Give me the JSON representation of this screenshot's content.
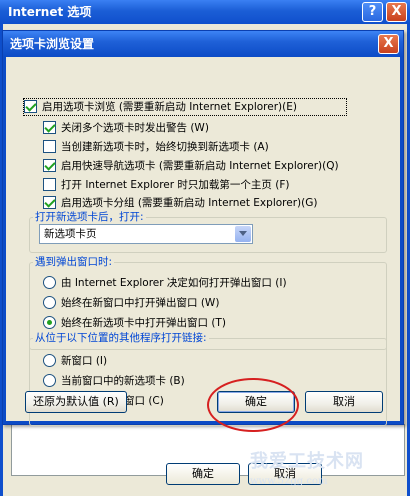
{
  "outer_window": {
    "title": "Internet 选项",
    "help_label": "?",
    "close_label": "X",
    "ok_label": "确定",
    "cancel_label": "取消",
    "watermark_main": "我爱工技术网",
    "watermark_sub": "www.52gg.com"
  },
  "dialog": {
    "title": "选项卡浏览设置",
    "close_label": "X",
    "enable_tabs": {
      "label": "启用选项卡浏览 (需要重新启动 Internet Explorer)(E)",
      "checked": true
    },
    "options": [
      {
        "label": "关闭多个选项卡时发出警告 (W)",
        "checked": true
      },
      {
        "label": "当创建新选项卡时，始终切换到新选项卡 (A)",
        "checked": false
      },
      {
        "label": "启用快速导航选项卡 (需要重新启动 Internet Explorer)(Q)",
        "checked": true
      },
      {
        "label": "打开 Internet Explorer 时只加载第一个主页 (F)",
        "checked": false
      },
      {
        "label": "启用选项卡分组 (需要重新启动 Internet Explorer)(G)",
        "checked": true
      }
    ],
    "new_tab_group": {
      "title": "打开新选项卡后，打开:",
      "selected": "新选项卡页"
    },
    "popup_group": {
      "title": "遇到弹出窗口时:",
      "options": [
        {
          "label": "由 Internet Explorer 决定如何打开弹出窗口 (I)",
          "checked": false
        },
        {
          "label": "始终在新窗口中打开弹出窗口 (W)",
          "checked": false
        },
        {
          "label": "始终在新选项卡中打开弹出窗口 (T)",
          "checked": true
        }
      ]
    },
    "links_group": {
      "title": "从位于以下位置的其他程序打开链接:",
      "options": [
        {
          "label": "新窗口 (I)",
          "checked": false
        },
        {
          "label": "当前窗口中的新选项卡 (B)",
          "checked": false
        },
        {
          "label": "当前选项卡或窗口 (C)",
          "checked": true
        }
      ]
    },
    "restore_label": "还原为默认值 (R)",
    "ok_label": "确定",
    "cancel_label": "取消"
  },
  "colors": {
    "titlebar": "#0c4bc6",
    "group_title": "#0046d5",
    "check": "#21a121",
    "annotation_ring": "#d62020"
  }
}
